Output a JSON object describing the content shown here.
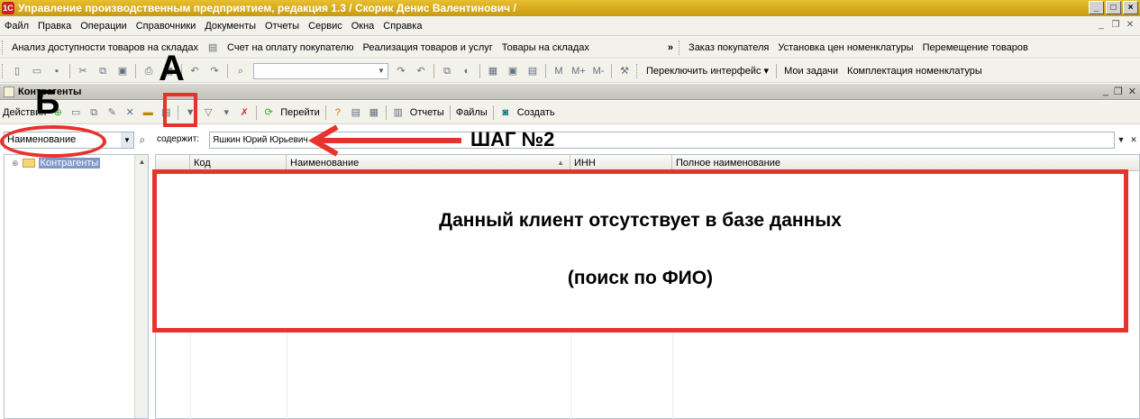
{
  "window": {
    "title": "Управление производственным предприятием, редакция 1.3 / Скорик Денис Валентинович /",
    "controls": [
      "_",
      "□",
      "×"
    ]
  },
  "menu": [
    "Файл",
    "Правка",
    "Операции",
    "Справочники",
    "Документы",
    "Отчеты",
    "Сервис",
    "Окна",
    "Справка"
  ],
  "panel1": {
    "left": [
      "Анализ доступности товаров на складах",
      "Счет на оплату покупателю",
      "Реализация товаров и услуг",
      "Товары на складах"
    ],
    "more": "»",
    "right": [
      "Заказ покупателя",
      "Установка цен номенклатуры",
      "Перемещение товаров"
    ]
  },
  "panel2": {
    "links": [
      "Переключить интерфейс ▾",
      "Мои задачи",
      "Комплектация номенклатуры"
    ]
  },
  "form": {
    "title": "Контрагенты",
    "actions_label": "Действия",
    "goto_label": "Перейти",
    "reports_label": "Отчеты",
    "files_label": "Файлы",
    "create_label": "Создать"
  },
  "search": {
    "field": "Наименование",
    "contains_label": "содержит:",
    "value": "Яшкин Юрий Юрьевич"
  },
  "tree": {
    "root": "Контрагенты"
  },
  "table": {
    "columns": [
      "Код",
      "Наименование",
      "ИНН",
      "Полное наименование"
    ]
  },
  "annotations": {
    "label_a": "А",
    "label_b": "Б",
    "step": "ШАГ №2",
    "message_line1": "Данный клиент отсутствует в базе данных",
    "message_line2": "(поиск по ФИО)",
    "accent_color": "#e8322c"
  }
}
